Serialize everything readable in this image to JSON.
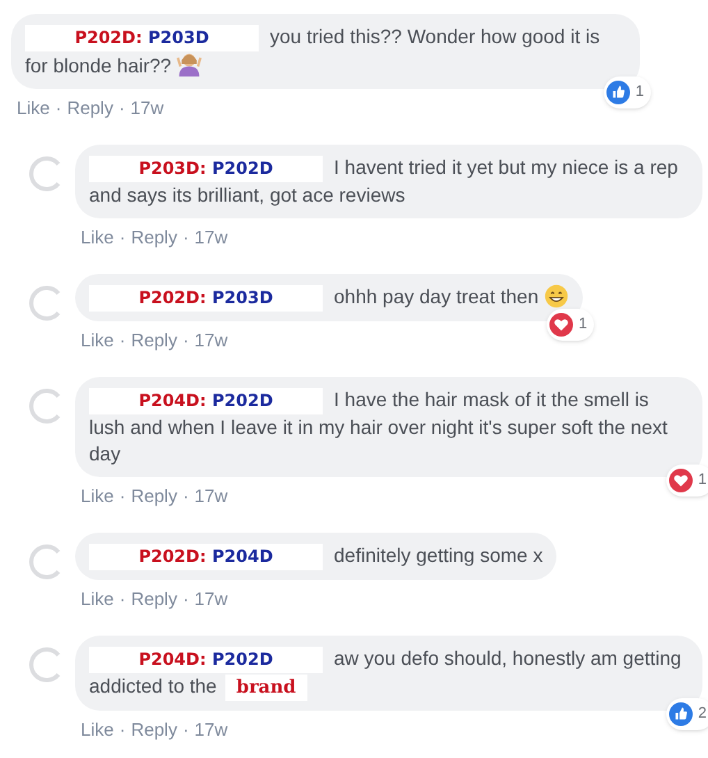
{
  "comments": [
    {
      "reply": false,
      "from": "P202D:",
      "to": "P203D",
      "text": "you tried this?? Wonder how good it is for blonde hair??",
      "emoji": {
        "kind": "person"
      },
      "actions": [
        {
          "kind": "link",
          "text": "Like"
        },
        {
          "kind": "dot",
          "text": "·"
        },
        {
          "kind": "link",
          "text": "Reply"
        },
        {
          "kind": "dot",
          "text": "·"
        },
        {
          "kind": "time",
          "text": "17w"
        }
      ],
      "reaction": {
        "kind": "like",
        "count": "1"
      }
    },
    {
      "reply": true,
      "from": "P203D:",
      "to": "P202D",
      "text": "I havent tried it yet but my niece is a rep and says its brilliant, got ace reviews",
      "actions": [
        {
          "kind": "link",
          "text": "Like"
        },
        {
          "kind": "dot",
          "text": "·"
        },
        {
          "kind": "link",
          "text": "Reply"
        },
        {
          "kind": "dot",
          "text": "·"
        },
        {
          "kind": "time",
          "text": "17w"
        }
      ]
    },
    {
      "reply": true,
      "from": "P202D:",
      "to": "P203D",
      "text": "ohhh pay day treat then",
      "emoji": {
        "kind": "grin"
      },
      "actions": [
        {
          "kind": "link",
          "text": "Like"
        },
        {
          "kind": "dot",
          "text": "·"
        },
        {
          "kind": "link",
          "text": "Reply"
        },
        {
          "kind": "dot",
          "text": "·"
        },
        {
          "kind": "time",
          "text": "17w"
        }
      ],
      "reaction": {
        "kind": "love",
        "count": "1"
      }
    },
    {
      "reply": true,
      "from": "P204D:",
      "to": "P202D",
      "text": "I have the hair mask of it the smell is lush and when I leave it in my hair over night it's super soft the next day",
      "actions": [
        {
          "kind": "link",
          "text": "Like"
        },
        {
          "kind": "dot",
          "text": "·"
        },
        {
          "kind": "link",
          "text": "Reply"
        },
        {
          "kind": "dot",
          "text": "·"
        },
        {
          "kind": "time",
          "text": "17w"
        }
      ],
      "reaction": {
        "kind": "love",
        "count": "1"
      }
    },
    {
      "reply": true,
      "from": "P202D:",
      "to": "P204D",
      "text": "definitely getting some x",
      "actions": [
        {
          "kind": "link",
          "text": "Like"
        },
        {
          "kind": "dot",
          "text": "·"
        },
        {
          "kind": "link",
          "text": "Reply"
        },
        {
          "kind": "dot",
          "text": "·"
        },
        {
          "kind": "time",
          "text": "17w"
        }
      ]
    },
    {
      "reply": true,
      "from": "P204D:",
      "to": "P202D",
      "text": "aw you defo should, honestly am getting addicted to the",
      "brand": "brand",
      "actions": [
        {
          "kind": "link",
          "text": "Like"
        },
        {
          "kind": "dot",
          "text": "·"
        },
        {
          "kind": "link",
          "text": "Reply"
        },
        {
          "kind": "dot",
          "text": "·"
        },
        {
          "kind": "time",
          "text": "17w"
        }
      ],
      "reaction": {
        "kind": "like",
        "count": "2"
      }
    }
  ]
}
